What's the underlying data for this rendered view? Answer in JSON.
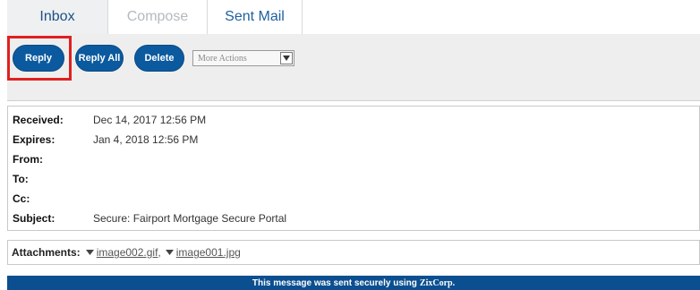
{
  "tabs": [
    {
      "label": "Inbox"
    },
    {
      "label": "Compose"
    },
    {
      "label": "Sent Mail"
    }
  ],
  "toolbar": {
    "reply_label": "Reply",
    "reply_all_label": "Reply All",
    "delete_label": "Delete",
    "more_actions": {
      "selected": "More Actions"
    }
  },
  "message": {
    "fields": [
      {
        "label": "Received:",
        "value": "Dec 14, 2017 12:56 PM"
      },
      {
        "label": "Expires:",
        "value": "Jan 4, 2018 12:56 PM"
      },
      {
        "label": "From:",
        "value": ""
      },
      {
        "label": "To:",
        "value": ""
      },
      {
        "label": "Cc:",
        "value": ""
      },
      {
        "label": "Subject:",
        "value": "Secure: Fairport Mortgage Secure Portal"
      }
    ]
  },
  "attachments": {
    "label": "Attachments:",
    "files": [
      {
        "name": "image002.gif"
      },
      {
        "name": "image001.jpg"
      }
    ],
    "separator": ","
  },
  "footer": {
    "text": "This message was sent securely using",
    "brand": "ZixCorp."
  },
  "colors": {
    "accent": "#0b5a9f",
    "highlight": "#e02020",
    "footer_bg": "#0c4f90"
  }
}
